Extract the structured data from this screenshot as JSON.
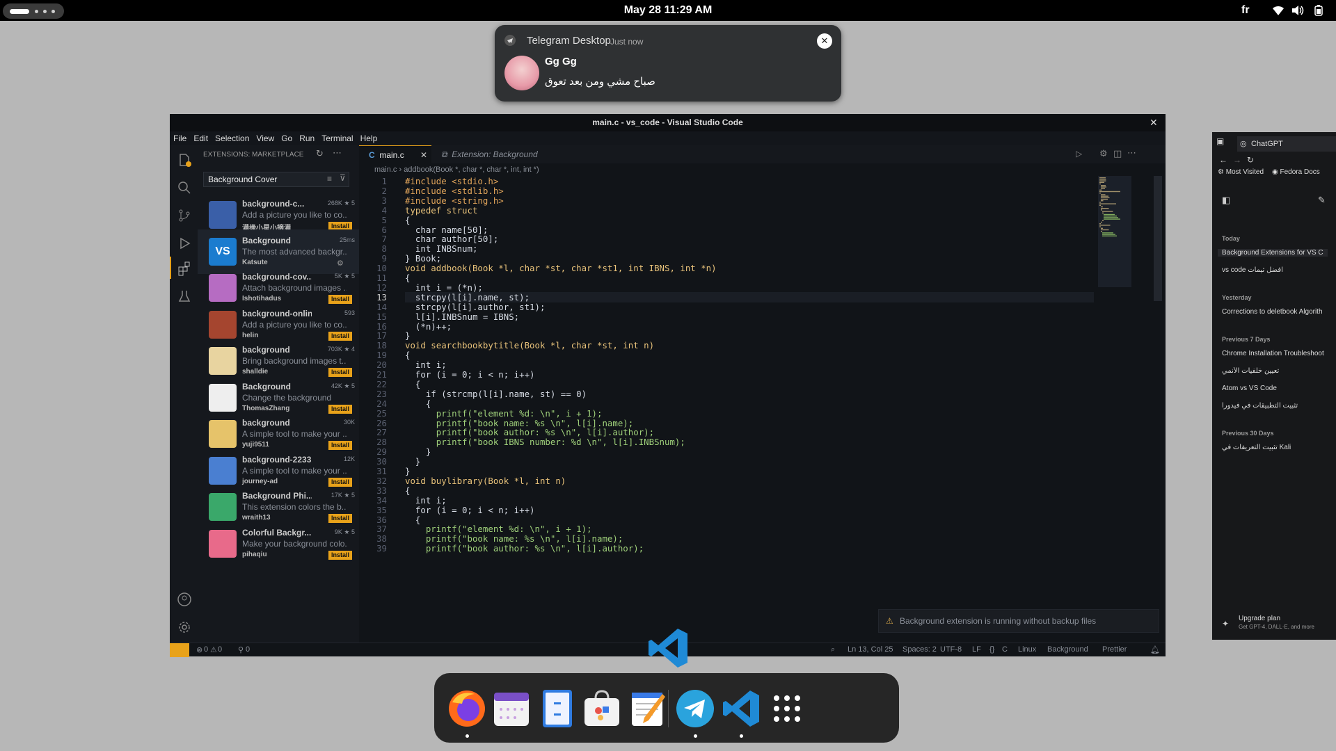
{
  "topbar": {
    "clock": "May 28  11:29 AM",
    "keyboard_layout": "fr",
    "tray_icons": [
      "wifi-icon",
      "volume-icon",
      "battery-icon"
    ]
  },
  "notification": {
    "app": "Telegram Desktop",
    "time": "Just now",
    "sender": "Gg Gg",
    "message": "صباح مشي ومن بعد تعوق"
  },
  "vscode": {
    "title": "main.c - vs_code - Visual Studio Code",
    "menu": [
      "File",
      "Edit",
      "Selection",
      "View",
      "Go",
      "Run",
      "Terminal",
      "Help"
    ],
    "sidebar": {
      "header": "EXTENSIONS: MARKETPLACE",
      "search_value": "Background Cover",
      "extensions": [
        {
          "name": "background-c...",
          "desc": "Add a picture you like to co...",
          "author": "满缘小星小摘满",
          "stats": "268K ★ 5",
          "button": "Install",
          "color": "#3a5fa8"
        },
        {
          "name": "Background",
          "desc": "The most advanced backgr...",
          "author": "Katsute",
          "stats": "25ms",
          "button": "",
          "color": "#1b7ccf"
        },
        {
          "name": "background-cov...",
          "desc": "Attach background images ...",
          "author": "Ishotihadus",
          "stats": "5K ★ 5",
          "button": "Install",
          "color": "#b66cc2"
        },
        {
          "name": "background-online",
          "desc": "Add a picture you like to co...",
          "author": "helin",
          "stats": "593",
          "button": "Install",
          "color": "#a5452f"
        },
        {
          "name": "background",
          "desc": "Bring background images t...",
          "author": "shalldie",
          "stats": "703K ★ 4",
          "button": "Install",
          "color": "#e8d4a0"
        },
        {
          "name": "Background",
          "desc": "Change the background",
          "author": "ThomasZhang",
          "stats": "42K ★ 5",
          "button": "Install",
          "color": "#eeeeee"
        },
        {
          "name": "background",
          "desc": "A simple tool to make your ...",
          "author": "yuji9511",
          "stats": "30K",
          "button": "Install",
          "color": "#e6c36a"
        },
        {
          "name": "background-2233",
          "desc": "A simple tool to make your ...",
          "author": "journey-ad",
          "stats": "12K",
          "button": "Install",
          "color": "#4a7fd1"
        },
        {
          "name": "Background Phi...",
          "desc": "This extension colors the b...",
          "author": "wraith13",
          "stats": "17K ★ 5",
          "button": "Install",
          "color": "#3aa86a"
        },
        {
          "name": "Colorful Backgr...",
          "desc": "Make your background colo...",
          "author": "pihaqiu",
          "stats": "9K ★ 5",
          "button": "Install",
          "color": "#e86a8a"
        }
      ]
    },
    "tabs": [
      {
        "label": "main.c",
        "active": true
      },
      {
        "label": "Extension: Background",
        "active": false
      }
    ],
    "breadcrumb": {
      "file": "main.c",
      "symbol": "addbook(Book *, char *, char *, int, int *)"
    },
    "code": [
      "#include <stdio.h>",
      "#include <stdlib.h>",
      "#include <string.h>",
      "typedef struct",
      "{",
      "  char name[50];",
      "  char author[50];",
      "  int INBSnum;",
      "} Book;",
      "void addbook(Book *l, char *st, char *st1, int IBNS, int *n)",
      "{",
      "  int i = (*n);",
      "  strcpy(l[i].name, st);",
      "  strcpy(l[i].author, st1);",
      "  l[i].INBSnum = IBNS;",
      "  (*n)++;",
      "}",
      "void searchbookbytitle(Book *l, char *st, int n)",
      "{",
      "  int i;",
      "  for (i = 0; i < n; i++)",
      "  {",
      "    if (strcmp(l[i].name, st) == 0)",
      "    {",
      "      printf(\"element %d: \\n\", i + 1);",
      "      printf(\"book name: %s \\n\", l[i].name);",
      "      printf(\"book author: %s \\n\", l[i].author);",
      "      printf(\"book IBNS number: %d \\n\", l[i].INBSnum);",
      "    }",
      "  }",
      "}",
      "void buylibrary(Book *l, int n)",
      "{",
      "  int i;",
      "  for (i = 0; i < n; i++)",
      "  {",
      "    printf(\"element %d: \\n\", i + 1);",
      "    printf(\"book name: %s \\n\", l[i].name);",
      "    printf(\"book author: %s \\n\", l[i].author);"
    ],
    "toast": "Background extension is running without backup files",
    "status": {
      "errors": "0",
      "warnings": "0",
      "ports": "0",
      "position": "Ln 13, Col 25",
      "spaces": "Spaces: 2",
      "encoding": "UTF-8",
      "eol": "LF",
      "language": "C",
      "os": "Linux",
      "background": "Background",
      "prettier": "Prettier"
    }
  },
  "browser": {
    "tab": "ChatGPT",
    "bookmarks": [
      "Most Visited",
      "Fedora Docs"
    ],
    "sections": [
      {
        "heading": "Today",
        "items": [
          "Background Extensions for VS C",
          "vs code افضل ثيمات"
        ]
      },
      {
        "heading": "Yesterday",
        "items": [
          "Corrections to deletbook Algorith"
        ]
      },
      {
        "heading": "Previous 7 Days",
        "items": [
          "Chrome Installation Troubleshoot",
          "تعيين خلفيات الأنمي",
          "Atom vs VS Code",
          "تثبيت التطبيقات في فيدورا"
        ]
      },
      {
        "heading": "Previous 30 Days",
        "items": [
          "تثبيت التعريفات في Kali"
        ]
      }
    ],
    "upgrade_title": "Upgrade plan",
    "upgrade_sub": "Get GPT-4, DALL·E, and more"
  },
  "dock": {
    "apps": [
      "firefox-icon",
      "calendar-icon",
      "files-icon",
      "software-icon",
      "text-editor-icon",
      "telegram-icon",
      "vscode-icon",
      "app-grid-icon"
    ]
  }
}
